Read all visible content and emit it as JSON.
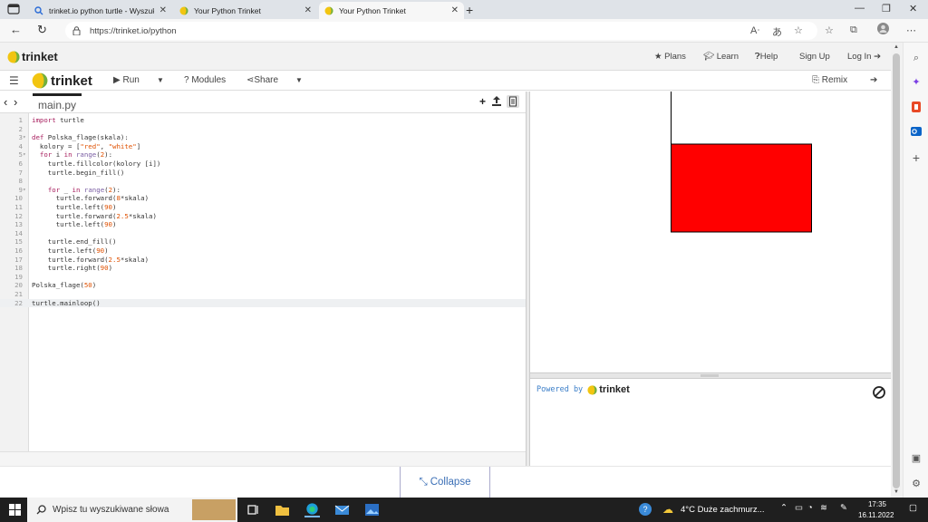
{
  "browser": {
    "tabs": [
      {
        "label": "trinket.io python turtle - Wyszuk",
        "active": false
      },
      {
        "label": "Your Python Trinket",
        "active": false
      },
      {
        "label": "Your Python Trinket",
        "active": true
      }
    ],
    "new_tab": "+",
    "url": "https://trinket.io/python"
  },
  "site_header": {
    "logo": "trinket",
    "nav": {
      "plans": "Plans",
      "learn": "Learn",
      "help": "Help",
      "signup": "Sign Up",
      "login": "Log In"
    }
  },
  "toolbar": {
    "logo": "trinket",
    "run": "Run",
    "modules": "Modules",
    "share": "Share",
    "remix": "Remix"
  },
  "editor": {
    "filename": "main.py",
    "lines": [
      {
        "n": "1",
        "fold": "",
        "text": "import turtle"
      },
      {
        "n": "2",
        "fold": "",
        "text": ""
      },
      {
        "n": "3",
        "fold": "▾",
        "text": "def Polska_flage(skala):"
      },
      {
        "n": "4",
        "fold": "",
        "text": "  kolory = [\"red\", \"white\"]"
      },
      {
        "n": "5",
        "fold": "▾",
        "text": "  for i in range(2):"
      },
      {
        "n": "6",
        "fold": "",
        "text": "    turtle.fillcolor(kolory [i])"
      },
      {
        "n": "7",
        "fold": "",
        "text": "    turtle.begin_fill()"
      },
      {
        "n": "8",
        "fold": "",
        "text": ""
      },
      {
        "n": "9",
        "fold": "▾",
        "text": "    for _ in range(2):"
      },
      {
        "n": "10",
        "fold": "",
        "text": "      turtle.forward(8*skala)"
      },
      {
        "n": "11",
        "fold": "",
        "text": "      turtle.left(90)"
      },
      {
        "n": "12",
        "fold": "",
        "text": "      turtle.forward(2.5*skala)"
      },
      {
        "n": "13",
        "fold": "",
        "text": "      turtle.left(90)"
      },
      {
        "n": "14",
        "fold": "",
        "text": ""
      },
      {
        "n": "15",
        "fold": "",
        "text": "    turtle.end_fill()"
      },
      {
        "n": "16",
        "fold": "",
        "text": "    turtle.left(90)"
      },
      {
        "n": "17",
        "fold": "",
        "text": "    turtle.forward(2.5*skala)"
      },
      {
        "n": "18",
        "fold": "",
        "text": "    turtle.right(90)"
      },
      {
        "n": "19",
        "fold": "",
        "text": ""
      },
      {
        "n": "20",
        "fold": "",
        "text": "Polska_flage(50)"
      },
      {
        "n": "21",
        "fold": "",
        "text": ""
      },
      {
        "n": "22",
        "fold": "",
        "text": "turtle.mainloop()"
      }
    ],
    "current_line": "22"
  },
  "output": {
    "flag_colors": {
      "top": "#ffffff",
      "bottom": "#ff0000",
      "stroke": "#000000"
    },
    "powered_by": "Powered by",
    "powered_logo": "trinket"
  },
  "collapse_label": "Collapse",
  "taskbar": {
    "search_placeholder": "Wpisz tu wyszukiwane słowa",
    "weather": "4°C  Duże zachmurz...",
    "time": "17:35",
    "date": "16.11.2022"
  },
  "colors": {
    "accent": "#3b6fb6",
    "trinket_yellow": "#f2c511",
    "trinket_green": "#6fb03f"
  }
}
